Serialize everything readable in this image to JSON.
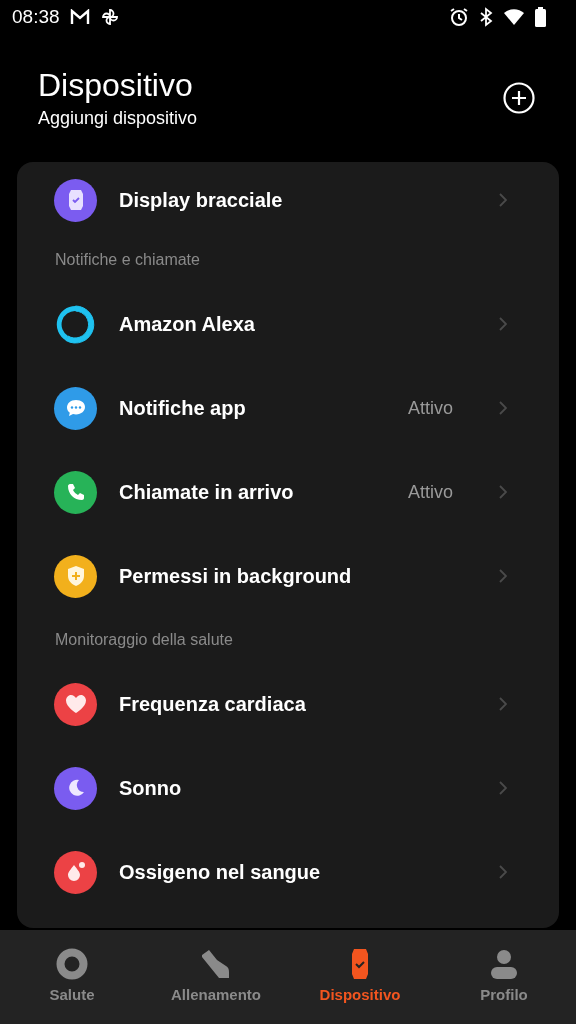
{
  "status_bar": {
    "time": "08:38"
  },
  "header": {
    "title": "Dispositivo",
    "subtitle": "Aggiungi dispositivo"
  },
  "list": [
    {
      "kind": "row",
      "color": "#7b5cf0",
      "label": "Display bracciale"
    },
    {
      "kind": "section",
      "label": "Notifiche e chiamate"
    },
    {
      "kind": "row",
      "color": "#1fc2f0",
      "label": "Amazon Alexa"
    },
    {
      "kind": "row",
      "color": "#2f9be8",
      "label": "Notifiche app",
      "value": "Attivo"
    },
    {
      "kind": "row",
      "color": "#27b358",
      "label": "Chiamate in arrivo",
      "value": "Attivo"
    },
    {
      "kind": "row",
      "color": "#f2b01c",
      "label": "Permessi in background"
    },
    {
      "kind": "section",
      "label": "Monitoraggio della salute"
    },
    {
      "kind": "row",
      "color": "#ec4245",
      "label": "Frequenza cardiaca"
    },
    {
      "kind": "row",
      "color": "#7a5cf0",
      "label": "Sonno"
    },
    {
      "kind": "row",
      "color": "#ec4245",
      "label": "Ossigeno nel sangue"
    }
  ],
  "nav": [
    {
      "label": "Salute",
      "selected": false
    },
    {
      "label": "Allenamento",
      "selected": false
    },
    {
      "label": "Dispositivo",
      "selected": true
    },
    {
      "label": "Profilo",
      "selected": false
    }
  ]
}
